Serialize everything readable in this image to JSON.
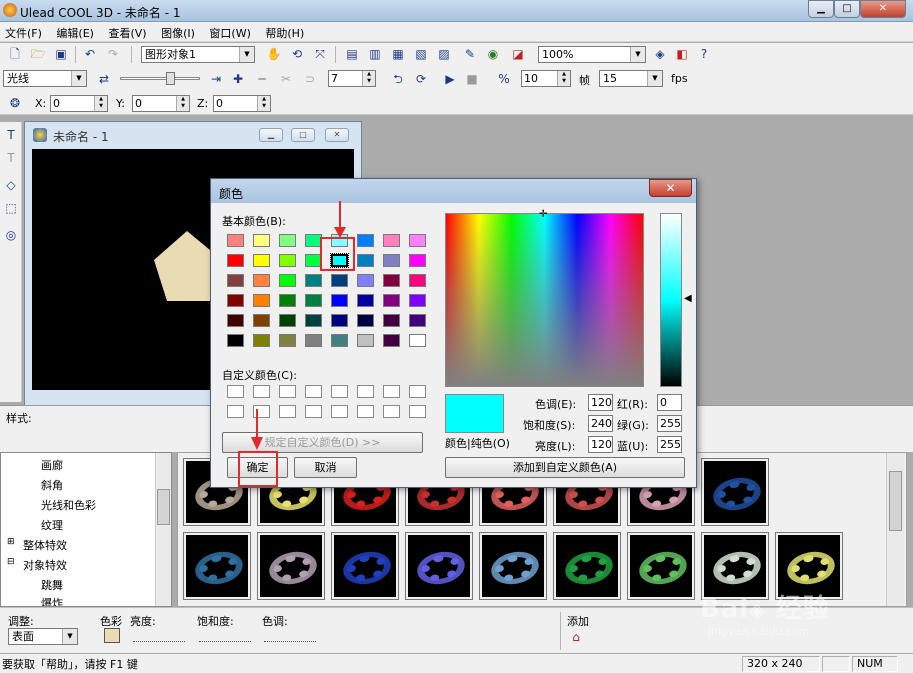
{
  "app": {
    "title": "Ulead COOL 3D - 未命名 - 1"
  },
  "menu": [
    "文件(F)",
    "编辑(E)",
    "查看(V)",
    "图像(I)",
    "窗口(W)",
    "帮助(H)"
  ],
  "toolbar1": {
    "object_combo": "图形对象1",
    "zoom_combo": "100%"
  },
  "toolbar2": {
    "light_combo": "光线",
    "frame_value": "7",
    "frames_value": "10",
    "frames_label": "帧",
    "fps_value": "15",
    "fps_label": "fps"
  },
  "toolbar3": {
    "x_label": "X:",
    "x_value": "0",
    "y_label": "Y:",
    "y_value": "0",
    "z_label": "Z:",
    "z_value": "0"
  },
  "doc": {
    "title": "未命名 - 1"
  },
  "style_label": "样式:",
  "tree": [
    "画廊",
    "斜角",
    "光线和色彩",
    "纹理",
    "整体特效",
    "对象特效",
    "跳舞",
    "爆炸"
  ],
  "bottom": {
    "adjust_label": "调整:",
    "adjust_value": "表面",
    "color_label": "色彩",
    "brightness_label": "亮度:",
    "saturation_label": "饱和度:",
    "hue_label": "色调:",
    "add_label": "添加"
  },
  "status": {
    "help": "要获取「帮助」，请按 F1 键",
    "size": "320 x 240",
    "num": "NUM"
  },
  "dialog": {
    "title": "颜色",
    "basic_label": "基本颜色(B):",
    "custom_label": "自定义颜色(C):",
    "define_button": "规定自定义颜色(D) >>",
    "ok_button": "确定",
    "cancel_button": "取消",
    "add_custom_button": "添加到自定义颜色(A)",
    "preview_label": "颜色|纯色(O)",
    "hue_label": "色调(E):",
    "hue_value": "120",
    "sat_label": "饱和度(S):",
    "sat_value": "240",
    "lum_label": "亮度(L):",
    "lum_value": "120",
    "red_label": "红(R):",
    "red_value": "0",
    "green_label": "绿(G):",
    "green_value": "255",
    "blue_label": "蓝(U):",
    "blue_value": "255",
    "selected_color": "#00ffff"
  },
  "basic_colors": [
    [
      "#ff8080",
      "#ffff80",
      "#80ff80",
      "#00ff80",
      "#80ffff",
      "#0080ff",
      "#ff80c0",
      "#ff80ff"
    ],
    [
      "#ff0000",
      "#ffff00",
      "#80ff00",
      "#00ff40",
      "#00ffff",
      "#0080c0",
      "#8080c0",
      "#ff00ff"
    ],
    [
      "#804040",
      "#ff8040",
      "#00ff00",
      "#008080",
      "#004080",
      "#8080ff",
      "#800040",
      "#ff0080"
    ],
    [
      "#800000",
      "#ff8000",
      "#008000",
      "#008040",
      "#0000ff",
      "#0000a0",
      "#800080",
      "#8000ff"
    ],
    [
      "#400000",
      "#804000",
      "#004000",
      "#004040",
      "#000080",
      "#000040",
      "#400040",
      "#400080"
    ],
    [
      "#000000",
      "#808000",
      "#808040",
      "#808080",
      "#408080",
      "#c0c0c0",
      "#400040",
      "#ffffff"
    ]
  ],
  "gallery_colors": [
    [
      "#b8a898",
      "#e8e070",
      "#d82020",
      "#c83030",
      "#e06060",
      "#d05050",
      "#d8a0b0",
      "#2050a0"
    ],
    [
      "#3070a0",
      "#b0a0b0",
      "#2040c0",
      "#6060e0",
      "#70a0d0",
      "#20a040",
      "#60c060",
      "#d0e0d0",
      "#e0e070"
    ]
  ]
}
